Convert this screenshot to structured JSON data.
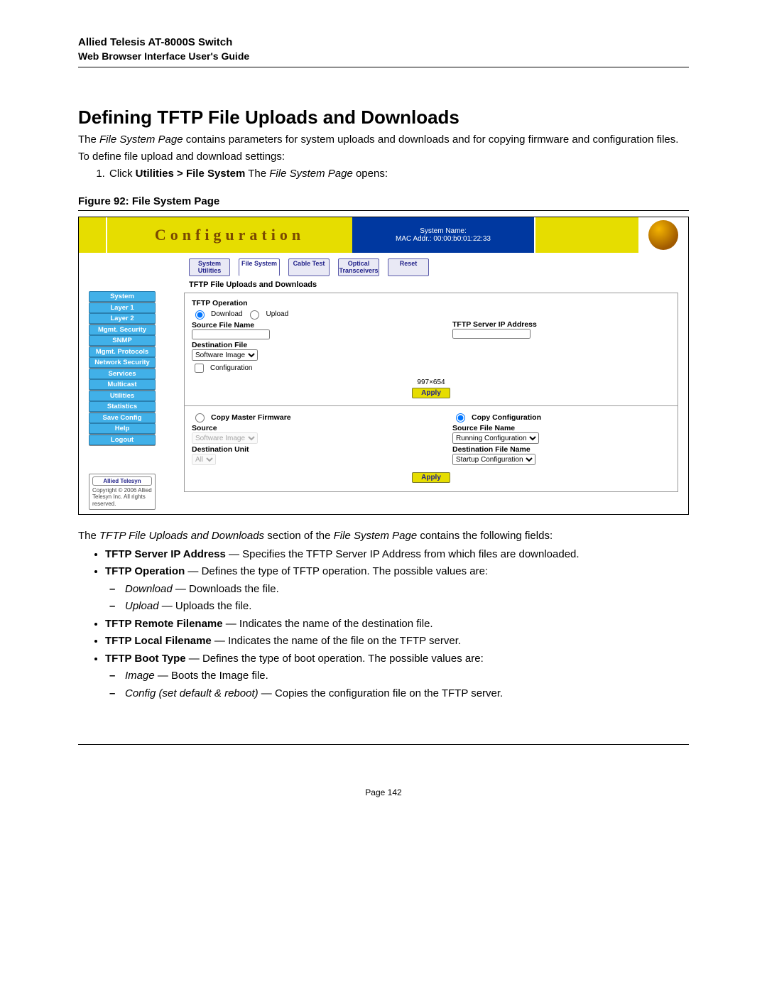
{
  "header": {
    "title": "Allied Telesis AT-8000S Switch",
    "subtitle": "Web Browser Interface User's Guide"
  },
  "section_title": "Defining TFTP File Uploads and Downloads",
  "intro": {
    "p1_pre": "The ",
    "p1_em": "File System Page",
    "p1_post": " contains parameters for system uploads and downloads and for copying firmware and configuration files.",
    "p2": "To define file upload and download settings:",
    "step1_pre": "Click ",
    "step1_bold": "Utilities > File System",
    "step1_mid": " The ",
    "step1_em": "File System Page",
    "step1_post": " opens:"
  },
  "figure_caption": "Figure 92:  File System Page",
  "screenshot": {
    "banner_title": "Configuration",
    "sys_name_lbl": "System Name:",
    "mac_lbl": "MAC Addr.: 00:00:b0:01:22:33",
    "tabs": [
      "System Utilities",
      "File System",
      "Cable Test",
      "Optical Transceivers",
      "Reset"
    ],
    "panel_heading": "TFTP File Uploads and Downloads",
    "sidebar": [
      "System",
      "Layer 1",
      "Layer 2",
      "Mgmt. Security",
      "SNMP",
      "Mgmt. Protocols",
      "Network Security",
      "Services",
      "Multicast",
      "Utilities",
      "Statistics",
      "Save Config",
      "Help",
      "Logout"
    ],
    "brand": "Allied Telesyn",
    "copyright": "Copyright © 2006 Allied Telesyn Inc. All rights reserved.",
    "tftp_op_lbl": "TFTP Operation",
    "download_lbl": "Download",
    "upload_lbl": "Upload",
    "src_file_lbl": "Source File Name",
    "server_ip_lbl": "TFTP Server IP Address",
    "dest_file_lbl": "Destination File",
    "dest_file_sel": "Software Image",
    "config_chk_lbl": "Configuration",
    "dims": "997×654",
    "apply": "Apply",
    "copy_master_lbl": "Copy Master Firmware",
    "source_lbl": "Source",
    "source_sel": "Software Image",
    "dest_unit_lbl": "Destination Unit",
    "dest_unit_sel": "All",
    "copy_cfg_lbl": "Copy Configuration",
    "src_file2_lbl": "Source File Name",
    "src_file2_sel": "Running Configuration",
    "dest_file2_lbl": "Destination File Name",
    "dest_file2_sel": "Startup Configuration"
  },
  "after_figure": {
    "lead_pre": "The ",
    "lead_em1": "TFTP File Uploads and Downloads",
    "lead_mid": " section of the ",
    "lead_em2": "File System Page",
    "lead_post": " contains the following fields:",
    "fields": [
      {
        "bold": "TFTP Server IP Address",
        "text": " — Specifies the TFTP Server IP Address from which files are downloaded."
      },
      {
        "bold": "TFTP Operation",
        "text": " — Defines the type of TFTP operation. The possible values are:",
        "sub": [
          {
            "em": "Download",
            "rest": " — Downloads the file."
          },
          {
            "em": "Upload",
            "rest": " — Uploads the file."
          }
        ]
      },
      {
        "bold": "TFTP Remote Filename",
        "text": " — Indicates the name of the destination file."
      },
      {
        "bold": "TFTP Local Filename",
        "text": " — Indicates the name of the file on the TFTP server."
      },
      {
        "bold": "TFTP Boot Type",
        "text": " — Defines the type of boot operation. The possible values are:",
        "sub": [
          {
            "em": "Image",
            "rest": " — Boots the Image file."
          },
          {
            "em": "Config (set default & reboot)",
            "rest": " — Copies the configuration file on the TFTP server."
          }
        ]
      }
    ]
  },
  "page_number": "Page 142"
}
